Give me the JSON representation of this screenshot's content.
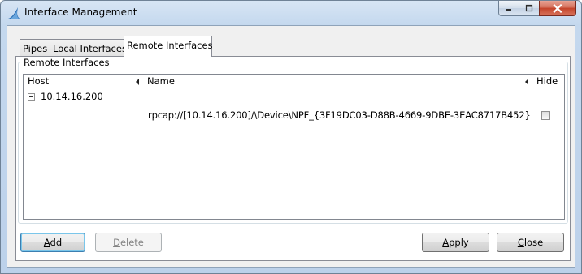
{
  "window": {
    "title": "Interface Management",
    "accent": "#2d6fb5"
  },
  "tabs": [
    {
      "label": "Pipes",
      "active": false
    },
    {
      "label": "Local Interfaces",
      "active": false
    },
    {
      "label": "Remote Interfaces",
      "active": true
    }
  ],
  "group": {
    "legend": "Remote Interfaces"
  },
  "table": {
    "columns": {
      "host": "Host",
      "name": "Name",
      "hide": "Hide"
    },
    "hosts": [
      {
        "host": "10.14.16.200",
        "expanded": true,
        "interfaces": [
          {
            "name": "rpcap://[10.14.16.200]/\\Device\\NPF_{3F19DC03-D88B-4669-9DBE-3EAC8717B452}",
            "hidden": false
          }
        ]
      }
    ]
  },
  "buttons": {
    "add": {
      "label": "Add",
      "mnemonic": "A",
      "rest": "dd"
    },
    "delete": {
      "label": "Delete",
      "mnemonic": "D",
      "rest": "elete",
      "disabled": true
    },
    "apply": {
      "label": "Apply",
      "mnemonic": "A",
      "rest": "pply"
    },
    "close": {
      "label": "Close",
      "mnemonic": "C",
      "rest": "lose"
    }
  }
}
